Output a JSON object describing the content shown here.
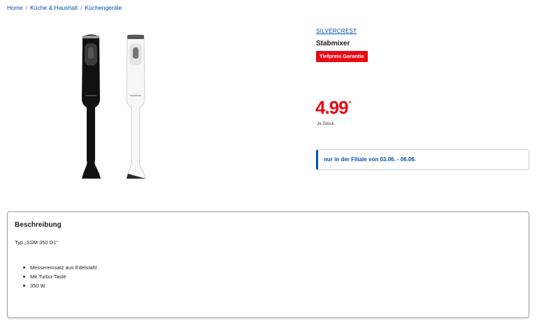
{
  "breadcrumb": {
    "items": [
      "Home",
      "Küche & Haushalt",
      "Küchengeräte"
    ],
    "separator": "/"
  },
  "product": {
    "brand": "SILVERCREST",
    "title": "Stabmixer",
    "badge": "Tiefpreis Garantie",
    "price": "4.99",
    "price_star": "*",
    "unit": "Je Stück",
    "availability": "nur in der Filiale von 03.06. - 06.06.",
    "image_alt": "Stabmixer schwarz und weiß"
  },
  "description": {
    "heading": "Beschreibung",
    "type_line": "Typ „SSM 350 D1“",
    "features": [
      "Messereinsatz aus Edelstahl",
      "Mit Turbo-Taste",
      "350 W"
    ]
  },
  "colors": {
    "accent_blue": "#0050aa",
    "price_red": "#e60a14"
  }
}
